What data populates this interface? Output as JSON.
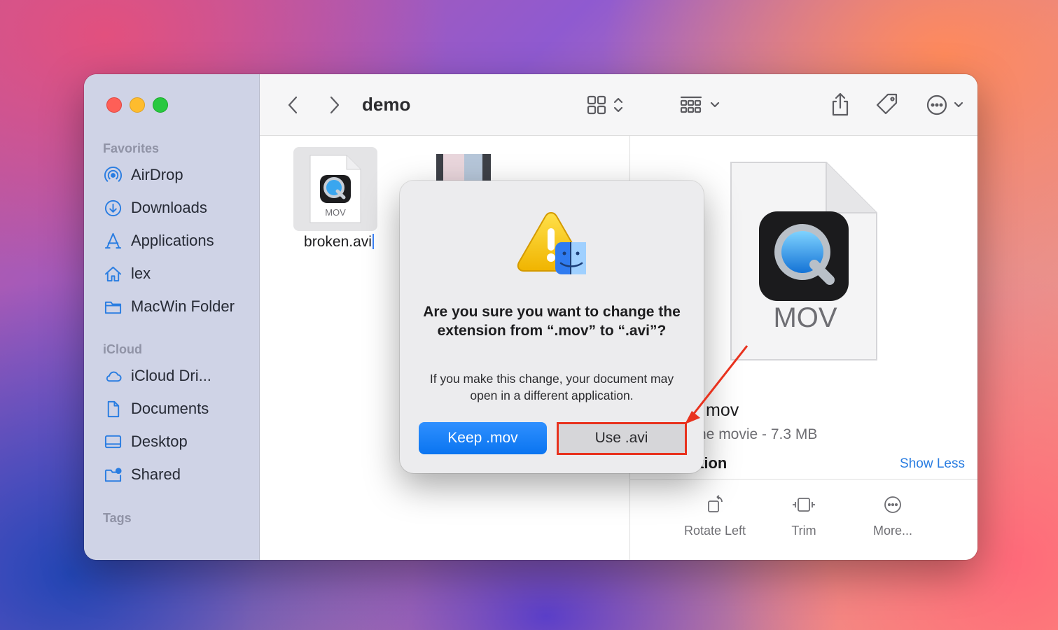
{
  "window": {
    "title": "demo"
  },
  "sidebar": {
    "favorites_label": "Favorites",
    "favorites": [
      {
        "label": "AirDrop",
        "icon": "airdrop-icon"
      },
      {
        "label": "Downloads",
        "icon": "downloads-icon"
      },
      {
        "label": "Applications",
        "icon": "applications-icon"
      },
      {
        "label": "lex",
        "icon": "home-icon"
      },
      {
        "label": "MacWin Folder",
        "icon": "folder-icon"
      }
    ],
    "icloud_label": "iCloud",
    "icloud": [
      {
        "label": "iCloud Dri...",
        "icon": "icloud-icon"
      },
      {
        "label": "Documents",
        "icon": "document-icon"
      },
      {
        "label": "Desktop",
        "icon": "desktop-icon"
      },
      {
        "label": "Shared",
        "icon": "shared-folder-icon"
      }
    ],
    "tags_label": "Tags"
  },
  "content": {
    "files": [
      {
        "name": "broken.avi",
        "badge": "MOV"
      }
    ]
  },
  "preview": {
    "doc_label": "MOV",
    "name_visible": "mov",
    "kind_visible": "ne movie - 7.3 MB",
    "info_visible": "tion",
    "show_less": "Show Less",
    "actions": [
      {
        "label": "Rotate Left",
        "icon": "rotate-left-icon"
      },
      {
        "label": "Trim",
        "icon": "trim-icon"
      },
      {
        "label": "More...",
        "icon": "more-icon"
      }
    ]
  },
  "dialog": {
    "title": "Are you sure you want to change the extension from “.mov” to “.avi”?",
    "message": "If you make this change, your document may open in a different application.",
    "primary_button": "Keep .mov",
    "secondary_button": "Use .avi"
  },
  "colors": {
    "accent": "#0a74f0",
    "annotation": "#e8321e",
    "sidebar_icon": "#2a7de1"
  }
}
